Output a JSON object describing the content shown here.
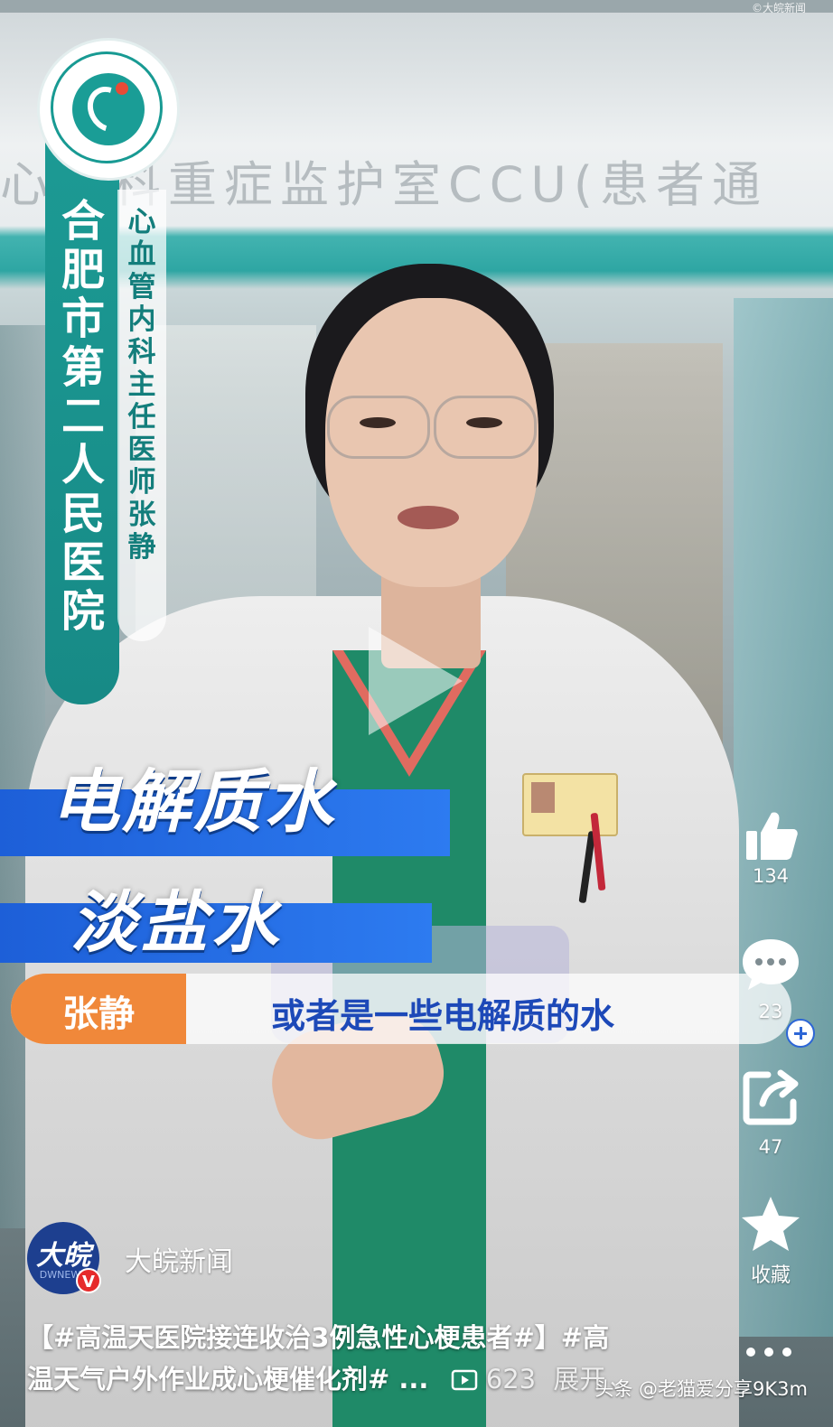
{
  "video": {
    "watermark_top": "©大皖新闻",
    "background_sign": "心内科重症监护室CCU(患者通",
    "hospital_vertical": "合肥市第二人民医院",
    "doctor_title_vertical": "心血管内科主任医师 张静",
    "caption_line1": "电解质水",
    "caption_line2": "淡盐水",
    "speaker_name": "张静",
    "subtitle": "或者是一些电解质的水"
  },
  "actions": {
    "like_count": "134",
    "comment_count": "23",
    "share_count": "47",
    "favorite_label": "收藏"
  },
  "author": {
    "avatar_text": "大皖",
    "avatar_sub": "DWNEWS",
    "verified_badge": "V",
    "name": "大皖新闻"
  },
  "description": {
    "line1": "【#高温天医院接连收治3例急性心梗患者#】#高",
    "line2": "温天气户外作业成心梗催化剂# ...",
    "play_count": "623",
    "expand_label": "展开"
  },
  "footer": {
    "source_watermark": "头条 @老猫爱分享9K3m"
  },
  "colors": {
    "hospital_teal": "#1c9a94",
    "caption_blue": "#2d7bf0",
    "name_orange": "#f0883a",
    "subtitle_blue": "#1d49b8"
  }
}
